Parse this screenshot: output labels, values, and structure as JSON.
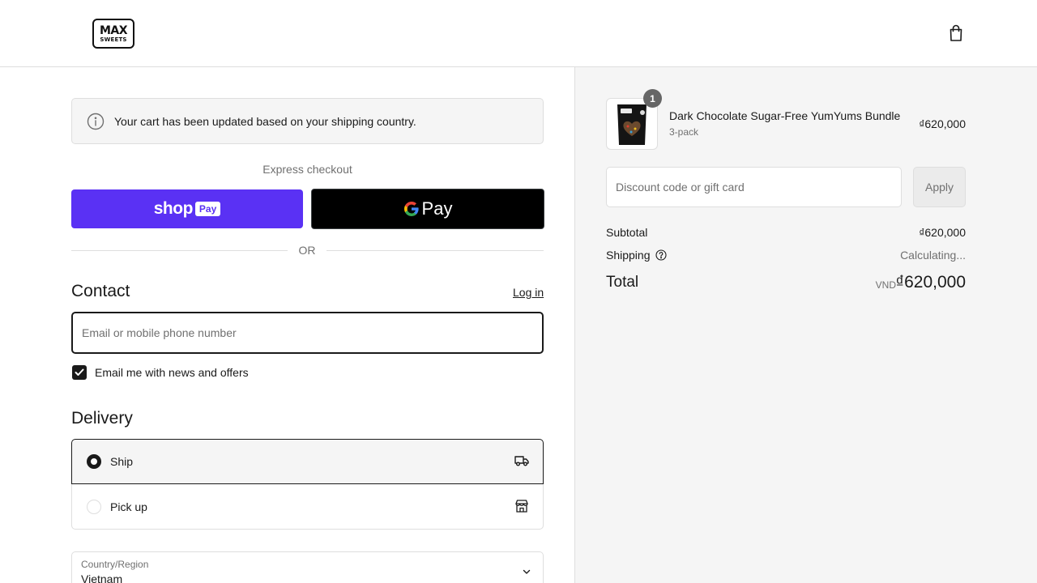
{
  "header": {
    "logo_line1": "MAX",
    "logo_line2": "SWEETS",
    "cart_icon": "shopping-bag-icon"
  },
  "notice": {
    "icon": "info-icon",
    "text": "Your cart has been updated based on your shipping country."
  },
  "express": {
    "label": "Express checkout",
    "shop_pay_text": "shop",
    "shop_pay_badge": "Pay",
    "gpay_g": "G",
    "gpay_text": "Pay",
    "or_label": "OR"
  },
  "contact": {
    "title": "Contact",
    "login_label": "Log in",
    "email_placeholder": "Email or mobile phone number",
    "email_value": "",
    "newsletter_label": "Email me with news and offers",
    "newsletter_checked": true
  },
  "delivery": {
    "title": "Delivery",
    "options": [
      {
        "label": "Ship",
        "selected": true,
        "icon": "truck-icon"
      },
      {
        "label": "Pick up",
        "selected": false,
        "icon": "store-icon"
      }
    ],
    "country_label": "Country/Region",
    "country_value": "Vietnam"
  },
  "summary": {
    "item": {
      "name": "Dark Chocolate Sugar-Free YumYums Bundle",
      "variant": "3-pack",
      "price": "₫620,000",
      "quantity": "1"
    },
    "discount_placeholder": "Discount code or gift card",
    "apply_label": "Apply",
    "subtotal_label": "Subtotal",
    "subtotal_value": "₫620,000",
    "shipping_label": "Shipping",
    "shipping_value": "Calculating...",
    "total_label": "Total",
    "currency": "VND",
    "total_value": "₫620,000"
  },
  "colors": {
    "shop_pay": "#5a31f4",
    "gpay": "#000000",
    "summary_bg": "#f5f5f5",
    "text": "#1a1a1a",
    "muted": "#707070",
    "border": "#dedede"
  }
}
